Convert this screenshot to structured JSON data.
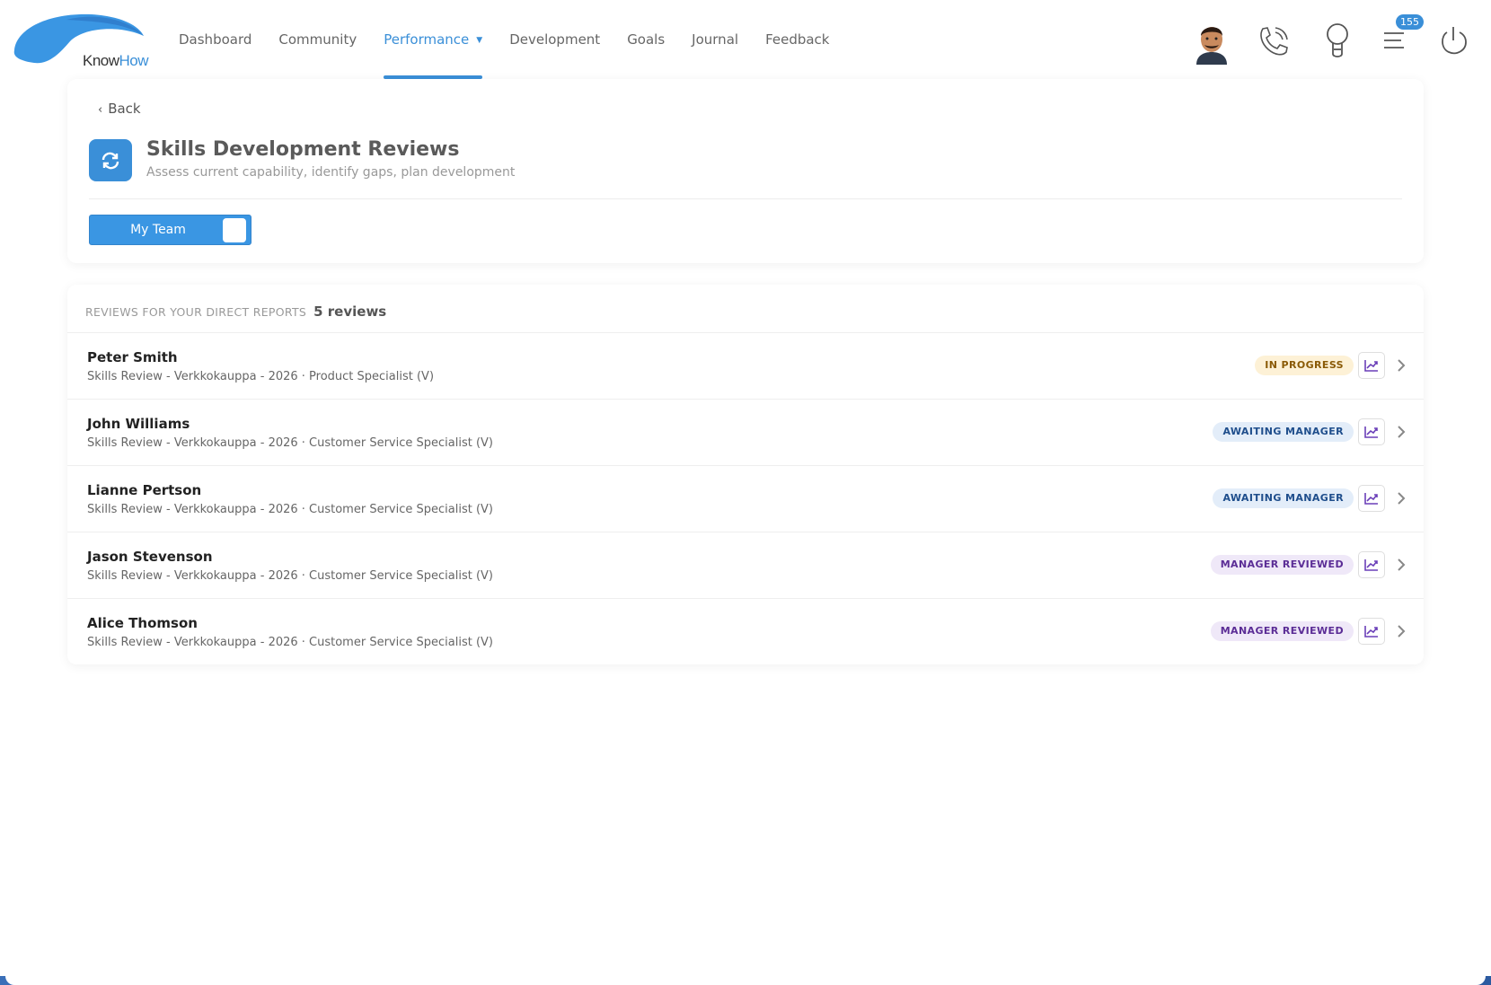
{
  "brand": {
    "logo_part1": "Know",
    "logo_part2": "How",
    "accent": "#3a8fd8"
  },
  "nav": {
    "items": [
      {
        "label": "Dashboard"
      },
      {
        "label": "Community"
      },
      {
        "label": "Performance",
        "active": true
      },
      {
        "label": "Development"
      },
      {
        "label": "Goals"
      },
      {
        "label": "Journal"
      },
      {
        "label": "Feedback"
      }
    ]
  },
  "header": {
    "notification_count": "155",
    "icons": [
      "avatar",
      "phone-icon",
      "lightbulb-icon",
      "menu-icon",
      "power-icon"
    ]
  },
  "page": {
    "back_label": "Back",
    "title": "Skills Development Reviews",
    "subtitle": "Assess current capability, identify gaps, plan development",
    "toggle_label": "My Team"
  },
  "list": {
    "heading": "REVIEWS FOR YOUR DIRECT REPORTS",
    "count": "5 reviews",
    "rows": [
      {
        "name": "Peter Smith",
        "desc": "Skills Review - Verkkokauppa - 2026 · Product Specialist (V)",
        "status": "IN PROGRESS",
        "status_bg": "#fdf1d6",
        "status_fg": "#8a5a06"
      },
      {
        "name": "John Williams",
        "desc": "Skills Review - Verkkokauppa - 2026 · Customer Service Specialist (V)",
        "status": "AWAITING MANAGER",
        "status_bg": "#e3edf9",
        "status_fg": "#1f4e8c"
      },
      {
        "name": "Lianne Pertson",
        "desc": "Skills Review - Verkkokauppa - 2026 · Customer Service Specialist (V)",
        "status": "AWAITING MANAGER",
        "status_bg": "#e3edf9",
        "status_fg": "#1f4e8c"
      },
      {
        "name": "Jason Stevenson",
        "desc": "Skills Review - Verkkokauppa - 2026 · Customer Service Specialist (V)",
        "status": "MANAGER REVIEWED",
        "status_bg": "#efe8f8",
        "status_fg": "#5b2d96"
      },
      {
        "name": "Alice Thomson",
        "desc": "Skills Review - Verkkokauppa - 2026 · Customer Service Specialist (V)",
        "status": "MANAGER REVIEWED",
        "status_bg": "#efe8f8",
        "status_fg": "#5b2d96"
      }
    ]
  }
}
